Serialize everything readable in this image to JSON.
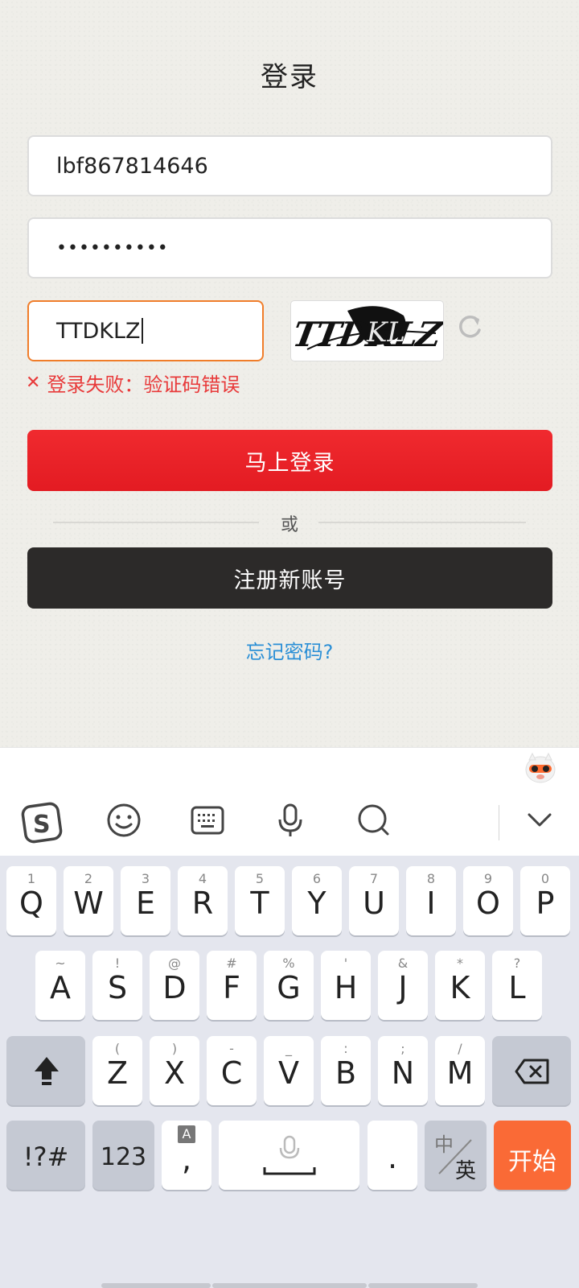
{
  "login": {
    "title": "登录",
    "username_value": "lbf867814646",
    "password_value": "••••••••••",
    "captcha_value": "TTDKLZ",
    "captcha_image_text": "TTDKLZ",
    "error_text": "登录失败：验证码错误",
    "login_button": "马上登录",
    "or_text": "或",
    "register_button": "注册新账号",
    "forgot_link": "忘记密码?"
  },
  "keyboard": {
    "toolbar_icons": [
      "sogou-logo-icon",
      "emoji-icon",
      "keyboard-icon",
      "microphone-icon",
      "search-icon",
      "chevron-down-icon"
    ],
    "row1": [
      {
        "main": "Q",
        "sub": "1"
      },
      {
        "main": "W",
        "sub": "2"
      },
      {
        "main": "E",
        "sub": "3"
      },
      {
        "main": "R",
        "sub": "4"
      },
      {
        "main": "T",
        "sub": "5"
      },
      {
        "main": "Y",
        "sub": "6"
      },
      {
        "main": "U",
        "sub": "7"
      },
      {
        "main": "I",
        "sub": "8"
      },
      {
        "main": "O",
        "sub": "9"
      },
      {
        "main": "P",
        "sub": "0"
      }
    ],
    "row2": [
      {
        "main": "A",
        "sub": "~"
      },
      {
        "main": "S",
        "sub": "!"
      },
      {
        "main": "D",
        "sub": "@"
      },
      {
        "main": "F",
        "sub": "#"
      },
      {
        "main": "G",
        "sub": "%"
      },
      {
        "main": "H",
        "sub": "'"
      },
      {
        "main": "J",
        "sub": "&"
      },
      {
        "main": "K",
        "sub": "*"
      },
      {
        "main": "L",
        "sub": "?"
      }
    ],
    "row3": [
      {
        "main": "Z",
        "sub": "("
      },
      {
        "main": "X",
        "sub": ")"
      },
      {
        "main": "C",
        "sub": "-"
      },
      {
        "main": "V",
        "sub": "_"
      },
      {
        "main": "B",
        "sub": ":"
      },
      {
        "main": "N",
        "sub": ";"
      },
      {
        "main": "M",
        "sub": "/"
      }
    ],
    "symbols_key": "!?#",
    "numbers_key": "123",
    "comma_key": ",",
    "comma_sub": "A",
    "period_key": ".",
    "lang_key_top": "中",
    "lang_key_bottom": "英",
    "start_key": "开始"
  },
  "colors": {
    "accent_red": "#e31b22",
    "dark_button": "#2c2a29",
    "link_blue": "#2a8fd6",
    "error_red": "#e83a3a",
    "start_orange": "#fa6a36"
  }
}
